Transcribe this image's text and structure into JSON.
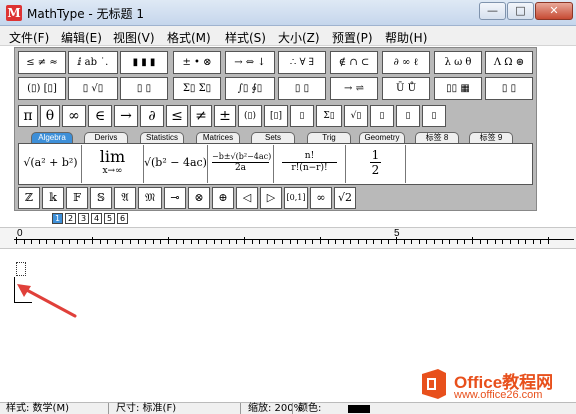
{
  "window": {
    "title": "MathType - 无标题 1",
    "app_icon_letter": "M",
    "min_glyph": "—",
    "max_glyph": "□",
    "close_glyph": "✕"
  },
  "menu": [
    "文件(F)",
    "编辑(E)",
    "视图(V)",
    "格式(M)",
    "样式(S)",
    "大小(Z)",
    "预置(P)",
    "帮助(H)"
  ],
  "toolbar": {
    "row1": [
      "≤ ≠ ≈",
      "ⅈ ab ˙.",
      "▮ ▮ ▮",
      "± • ⊗",
      "→ ⇔ ↓",
      "∴ ∀ ∃",
      "∉ ∩ ⊂",
      "∂ ∞ ℓ",
      "λ ω θ",
      "Λ Ω ⊛"
    ],
    "row2": [
      "(▯) [▯]",
      "▯ √▯",
      "▯ ▯",
      "Σ▯ Σ▯",
      "∫▯ ∮▯",
      "▯ ▯",
      "→ ⇌",
      "Ū Ů",
      "▯▯ ▦",
      "▯ ▯"
    ],
    "row3": [
      "π",
      "θ",
      "∞",
      "∈",
      "→",
      "∂",
      "≤",
      "≠",
      "±",
      "(▯)",
      "[▯]",
      "▯",
      "Σ▯",
      "√▯",
      "▯",
      "▯",
      "▯"
    ],
    "row5": [
      "ℤ",
      "𝕜",
      "𝔽",
      "𝕊",
      "𝔄",
      "𝔐",
      "⊸",
      "⊗",
      "⊕",
      "◁",
      "▷",
      "[0,1]",
      "∞",
      "√2"
    ]
  },
  "tabs": [
    {
      "label": "Algebra",
      "active": true
    },
    {
      "label": "Derivs",
      "active": false
    },
    {
      "label": "Statistics",
      "active": false
    },
    {
      "label": "Matrices",
      "active": false
    },
    {
      "label": "Sets",
      "active": false
    },
    {
      "label": "Trig",
      "active": false
    },
    {
      "label": "Geometry",
      "active": false
    },
    {
      "label": "标签 8",
      "active": false
    },
    {
      "label": "标签 9",
      "active": false
    }
  ],
  "templates": {
    "t1": "√(a² + b²)",
    "t2_lim": "lim",
    "t2_sub": "x→∞",
    "t3": "√(b² − 4ac)",
    "t4_num": "−b±√(b²−4ac)",
    "t4_den": "2a",
    "t5_num": "n!",
    "t5_den": "r!(n−r)!",
    "t6_num": "1",
    "t6_den": "2"
  },
  "small_tabs": [
    "1",
    "2",
    "3",
    "4",
    "5",
    "6"
  ],
  "ruler": {
    "mark_0": "0",
    "mark_5": "5"
  },
  "watermark": {
    "title": "Office教程网",
    "url": "www.office26.com"
  },
  "status": {
    "style": "样式: 数学(M)",
    "size": "尺寸: 标准(F)",
    "zoom": "缩放: 200%",
    "color": "颜色:"
  },
  "colors": {
    "accent": "#3d8fd8",
    "arrow": "#e0403a",
    "watermark": "#e8501c"
  }
}
